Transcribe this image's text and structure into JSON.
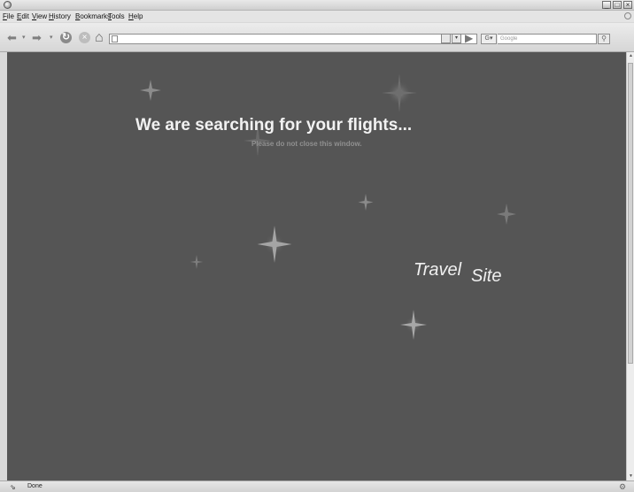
{
  "menu": {
    "items": [
      "File",
      "Edit",
      "View",
      "History",
      "Bookmarks",
      "Tools",
      "Help"
    ]
  },
  "toolbar": {
    "search_placeholder": "Google",
    "search_engine_label": "G",
    "url_value": ""
  },
  "page": {
    "headline": "We are searching for your flights...",
    "subline": "Please do not close this window.",
    "logo_part1": "Travel",
    "logo_part2": "Site",
    "background_color": "#555555"
  },
  "status": {
    "text": "Done"
  }
}
